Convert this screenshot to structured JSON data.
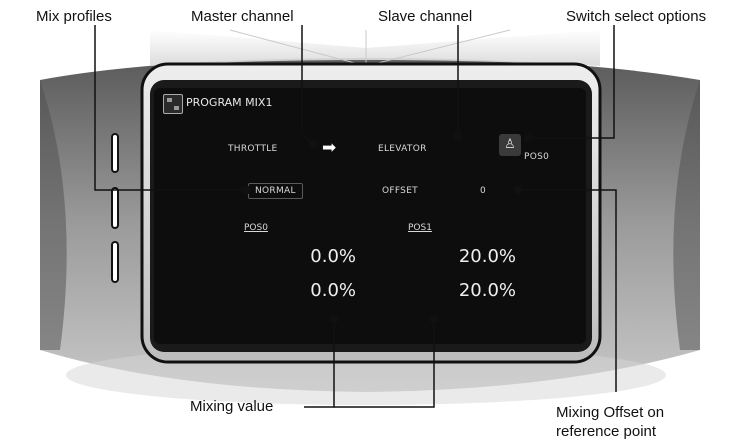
{
  "callouts": {
    "mix_profiles": "Mix profiles",
    "master_channel": "Master channel",
    "slave_channel": "Slave channel",
    "switch_select_options": "Switch select options",
    "mixing_value": "Mixing value",
    "mixing_offset_line1": "Mixing Offset on",
    "mixing_offset_line2": "reference point"
  },
  "screen": {
    "title": "PROGRAM MIX1",
    "title_icon": "mix-icon",
    "master_channel": "THROTTLE",
    "arrow_icon": "right-arrow-icon",
    "slave_channel": "ELEVATOR",
    "switch_icon": "switch-icon",
    "switch_position": "POS0",
    "profile": "NORMAL",
    "offset_label": "OFFSET",
    "offset_value": "0",
    "pos0_label": "POS0",
    "pos1_label": "POS1",
    "pos0_values": [
      "0.0%",
      "0.0%"
    ],
    "pos1_values": [
      "20.0%",
      "20.0%"
    ]
  },
  "colors": {
    "screen_background": "#0d0d0d",
    "screen_text": "#e6e6e6",
    "callout_line": "#111111",
    "bezel_gray": "#9a9a9a"
  }
}
